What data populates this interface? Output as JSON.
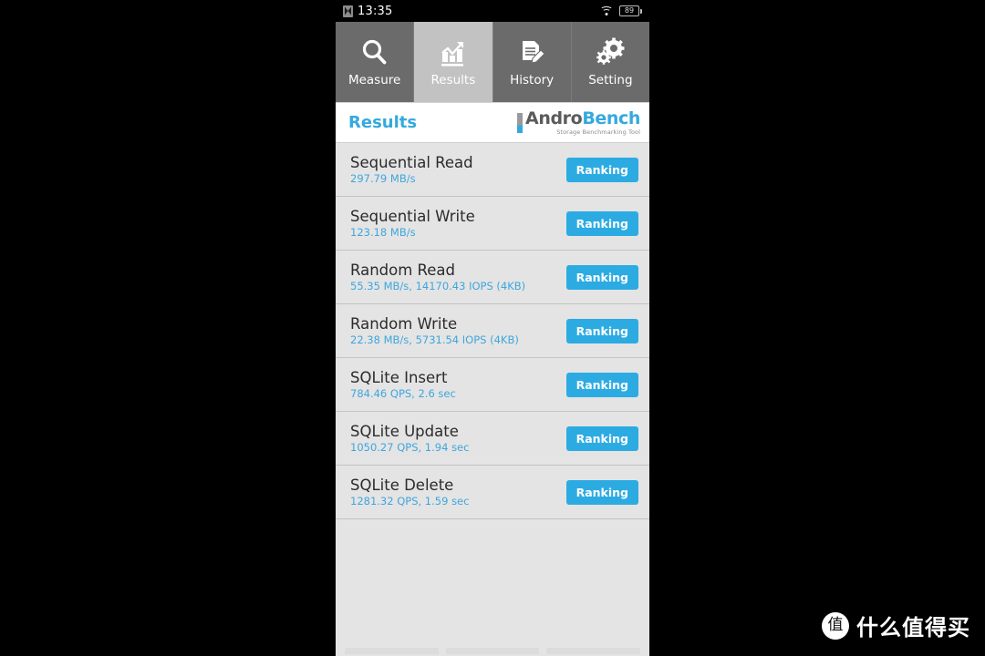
{
  "statusbar": {
    "sim_icon": "sim-card-icon",
    "time": "13:35",
    "wifi_icon": "wifi-icon",
    "battery_level": "89"
  },
  "tabs": [
    {
      "label": "Measure",
      "icon": "magnifier-icon",
      "active": false
    },
    {
      "label": "Results",
      "icon": "bar-chart-icon",
      "active": true
    },
    {
      "label": "History",
      "icon": "document-pen-icon",
      "active": false
    },
    {
      "label": "Setting",
      "icon": "gears-icon",
      "active": false
    }
  ],
  "header": {
    "title": "Results",
    "logo_andro": "Andro",
    "logo_bench": "Bench",
    "logo_tagline": "Storage Benchmarking Tool"
  },
  "results": [
    {
      "name": "Sequential Read",
      "value": "297.79 MB/s",
      "button": "Ranking"
    },
    {
      "name": "Sequential Write",
      "value": "123.18 MB/s",
      "button": "Ranking"
    },
    {
      "name": "Random Read",
      "value": "55.35 MB/s, 14170.43 IOPS (4KB)",
      "button": "Ranking"
    },
    {
      "name": "Random Write",
      "value": "22.38 MB/s, 5731.54 IOPS (4KB)",
      "button": "Ranking"
    },
    {
      "name": "SQLite Insert",
      "value": "784.46 QPS, 2.6 sec",
      "button": "Ranking"
    },
    {
      "name": "SQLite Update",
      "value": "1050.27 QPS, 1.94 sec",
      "button": "Ranking"
    },
    {
      "name": "SQLite Delete",
      "value": "1281.32 QPS, 1.59 sec",
      "button": "Ranking"
    }
  ],
  "watermark": {
    "badge": "值",
    "text": "什么值得买"
  },
  "colors": {
    "accent_blue": "#2cabe3",
    "value_blue": "#3ea6dd",
    "title_blue": "#35a9dd",
    "list_bg": "#e4e4e4",
    "tab_bg": "#6b6b6b",
    "tab_active_bg": "#c2c2c2",
    "statusbar_bg": "#000000"
  }
}
